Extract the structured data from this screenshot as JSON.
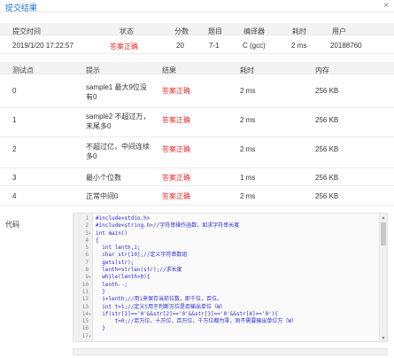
{
  "dialog": {
    "title": "提交结果",
    "close": "×"
  },
  "summary": {
    "headers": [
      "提交时间",
      "状态",
      "分数",
      "题目",
      "编译器",
      "耗时",
      "用户"
    ],
    "row": [
      "2019/1/20 17:22:57",
      "答案正确",
      "20",
      "7-1",
      "C (gcc)",
      "2 ms",
      "20188760"
    ]
  },
  "tests": {
    "headers": [
      "测试点",
      "提示",
      "结果",
      "耗时",
      "内存"
    ],
    "rows": [
      {
        "id": "0",
        "hint": "sample1 最大9位没有0",
        "result": "答案正确",
        "time": "2 ms",
        "mem": "256 KB"
      },
      {
        "id": "1",
        "hint": "sample2 不超过万，末尾多0",
        "result": "答案正确",
        "time": "2 ms",
        "mem": "256 KB"
      },
      {
        "id": "2",
        "hint": "不超过亿，中间连续多0",
        "result": "答案正确",
        "time": "2 ms",
        "mem": "256 KB"
      },
      {
        "id": "3",
        "hint": "最小个位数",
        "result": "答案正确",
        "time": "1 ms",
        "mem": "256 KB"
      },
      {
        "id": "4",
        "hint": "正常中间0",
        "result": "答案正确",
        "time": "2 ms",
        "mem": "256 KB"
      }
    ]
  },
  "code": {
    "label": "代码",
    "lines": [
      {
        "n": "1",
        "f": "",
        "t": "#include<stdio.h>"
      },
      {
        "n": "2",
        "f": "",
        "t": "#include<string.h>//字符串操作函数，如求字符串长度"
      },
      {
        "n": "3",
        "f": "▾",
        "t": "int main()"
      },
      {
        "n": "4",
        "f": "",
        "t": "{"
      },
      {
        "n": "5",
        "f": "",
        "t": "  int lenth,i;"
      },
      {
        "n": "6",
        "f": "",
        "t": "  char str[10];//定义字符串数组"
      },
      {
        "n": "7",
        "f": "",
        "t": "  gets(str);"
      },
      {
        "n": "8",
        "f": "",
        "t": "  lenth=strlen(str);//求长度"
      },
      {
        "n": "9",
        "f": "▾",
        "t": "  while(lenth>0){"
      },
      {
        "n": "10",
        "f": "",
        "t": "  lenth--;"
      },
      {
        "n": "11",
        "f": "",
        "t": "  }"
      },
      {
        "n": "12",
        "f": "",
        "t": "  i=lenth;//用i来保存当前位数，即千位，百位。"
      },
      {
        "n": "13",
        "f": "",
        "t": "  int t=1;//定义t用于判断万位是否输出单位（W）"
      },
      {
        "n": "14",
        "f": "▾",
        "t": "  if(str[1]=='0'&&str[2]=='0'&&str[3]=='0'&&str[4]=='0'){"
      },
      {
        "n": "15",
        "f": "",
        "t": "      t=0;//若万位，十万位，百万位，千万位都为零，则不需要输出单位万（W）"
      },
      {
        "n": "16",
        "f": "",
        "t": "  }"
      },
      {
        "n": "17",
        "f": "▾",
        "t": ""
      }
    ]
  }
}
